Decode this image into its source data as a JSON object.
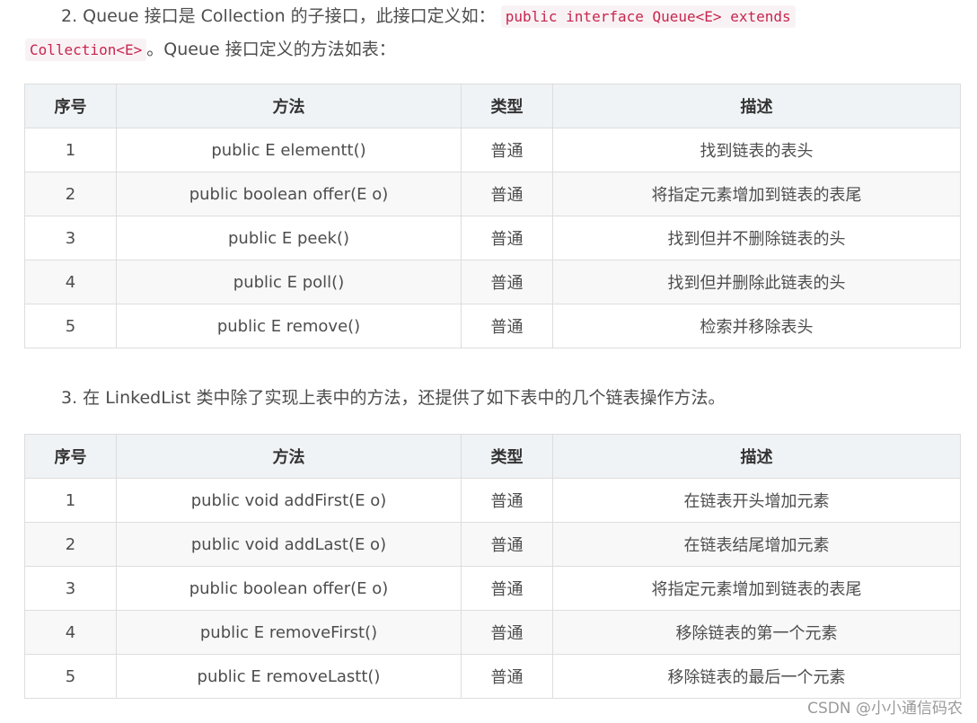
{
  "section1": {
    "text_before": "2. Queue 接口是 Collection 的子接口，此接口定义如：",
    "code1": "public interface Queue<E> extends",
    "code2": "Collection<E>",
    "text_after": "。Queue 接口定义的方法如表："
  },
  "table1": {
    "headers": [
      "序号",
      "方法",
      "类型",
      "描述"
    ],
    "rows": [
      [
        "1",
        "public E elementt()",
        "普通",
        "找到链表的表头"
      ],
      [
        "2",
        "public boolean offer(E o)",
        "普通",
        "将指定元素增加到链表的表尾"
      ],
      [
        "3",
        "public E peek()",
        "普通",
        "找到但并不删除链表的头"
      ],
      [
        "4",
        "public E poll()",
        "普通",
        "找到但并删除此链表的头"
      ],
      [
        "5",
        "public E remove()",
        "普通",
        "检索并移除表头"
      ]
    ]
  },
  "section2": {
    "text": "3. 在 LinkedList 类中除了实现上表中的方法，还提供了如下表中的几个链表操作方法。"
  },
  "table2": {
    "headers": [
      "序号",
      "方法",
      "类型",
      "描述"
    ],
    "rows": [
      [
        "1",
        "public void addFirst(E o)",
        "普通",
        "在链表开头增加元素"
      ],
      [
        "2",
        "public void addLast(E o)",
        "普通",
        "在链表结尾增加元素"
      ],
      [
        "3",
        "public boolean offer(E o)",
        "普通",
        "将指定元素增加到链表的表尾"
      ],
      [
        "4",
        "public E removeFirst()",
        "普通",
        "移除链表的第一个元素"
      ],
      [
        "5",
        "public E removeLastt()",
        "普通",
        "移除链表的最后一个元素"
      ]
    ]
  },
  "watermark": "CSDN @小小通信码农"
}
